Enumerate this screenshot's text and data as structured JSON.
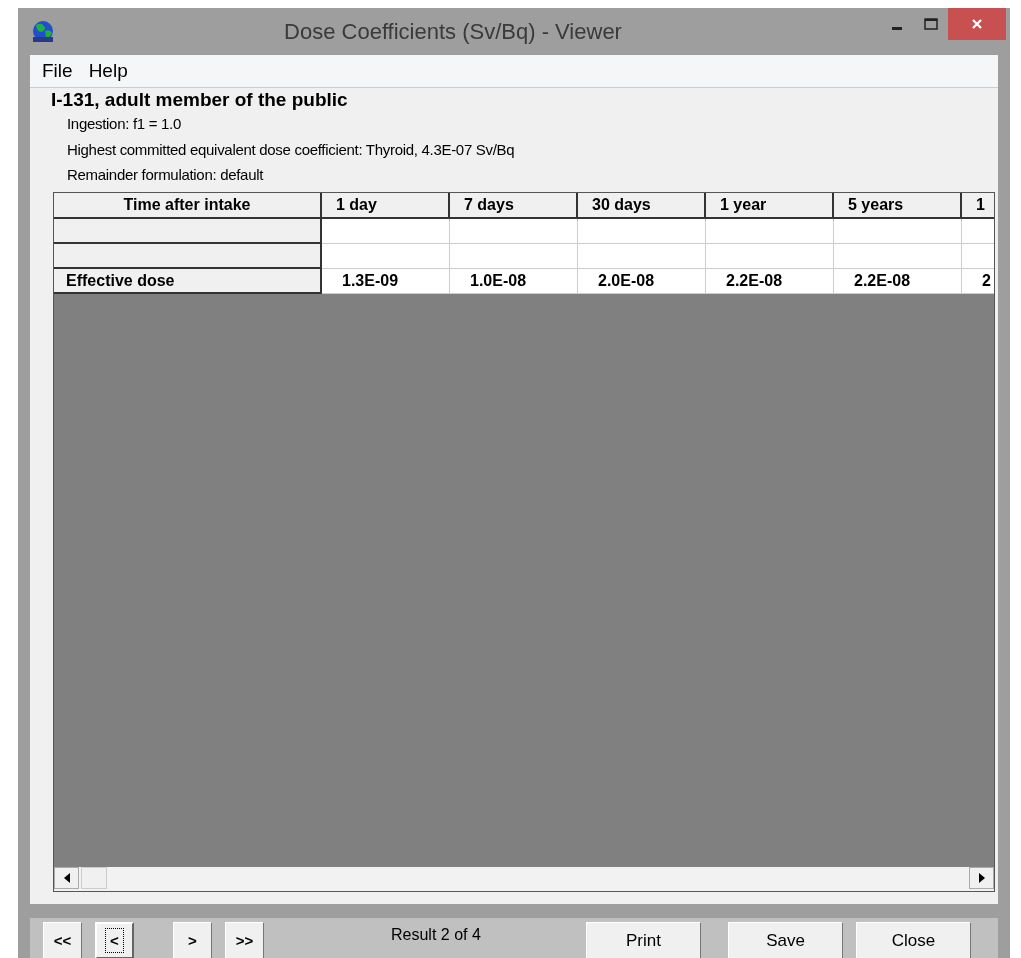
{
  "window": {
    "title": "Dose Coefficients (Sv/Bq) - Viewer"
  },
  "menu": [
    "File",
    "Help"
  ],
  "heading": "I-131, adult member of the public",
  "info_lines": [
    "Ingestion: f1 = 1.0",
    "Highest committed equivalent dose coefficient: Thyroid,  4.3E-07 Sv/Bq",
    "Remainder formulation: default"
  ],
  "table": {
    "columns": [
      "Time after intake",
      "1 day",
      "7 days",
      "30 days",
      "1 year",
      "5 years",
      "1"
    ],
    "rows": [
      {
        "cells": [
          "Effective dose",
          "1.3E-09",
          "1.0E-08",
          "2.0E-08",
          "2.2E-08",
          "2.2E-08",
          "2"
        ]
      }
    ]
  },
  "nav_buttons": [
    {
      "label": "<<",
      "focused": false
    },
    {
      "label": "<",
      "focused": true
    },
    {
      "label": ">",
      "focused": false
    },
    {
      "label": ">>",
      "focused": false
    }
  ],
  "status": "Result 2 of 4",
  "buttons": [
    "Print",
    "Save",
    "Close"
  ]
}
